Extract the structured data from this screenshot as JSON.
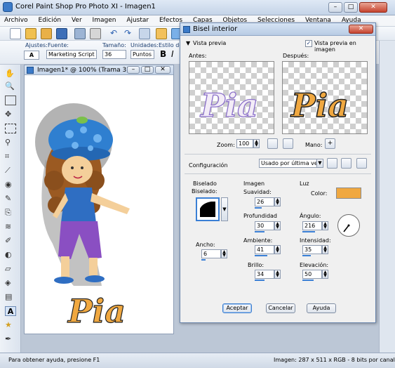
{
  "app": {
    "title": "Corel Paint Shop Pro Photo XI - Imagen1"
  },
  "menu": [
    "Archivo",
    "Edición",
    "Ver",
    "Imagen",
    "Ajustar",
    "Efectos",
    "Capas",
    "Objetos",
    "Selecciones",
    "Ventana",
    "Ayuda"
  ],
  "toolbar2": {
    "ajustes_label": "Ajustes:",
    "fuente_label": "Fuente:",
    "fuente_value": "Marketing Script",
    "tamano_label": "Tamaño:",
    "tamano_value": "36",
    "unidades_label": "Unidades:",
    "unidades_value": "Puntos",
    "estilo_label": "Estilo de F",
    "bold_label": "B",
    "italic_label": "I"
  },
  "image_window": {
    "title": "Imagen1* @ 100% (Trama 3)",
    "artwork_text": "Pia"
  },
  "dialog": {
    "title": "Bisel interior",
    "vista_previa_toggle": "Vista previa",
    "vista_previa_imagen": "Vista previa en imagen",
    "antes_label": "Antes:",
    "despues_label": "Después:",
    "preview_text": "Pia",
    "zoom_label": "Zoom:",
    "zoom_value": "100",
    "mano_label": "Mano:",
    "configuracion_label": "Configuración",
    "configuracion_value": "Usado por última vez",
    "biselado_group": "Biselado",
    "biselado_label": "Biselado:",
    "imagen_group": "Imagen",
    "luz_group": "Luz",
    "suavidad_label": "Suavidad:",
    "suavidad_value": "26",
    "profundidad_label": "Profundidad",
    "profundidad_value": "30",
    "ambiente_label": "Ambiente:",
    "ambiente_value": "41",
    "brillo_label": "Brillo:",
    "brillo_value": "34",
    "ancho_label": "Ancho:",
    "ancho_value": "6",
    "color_label": "Color:",
    "light_color": "#f0a840",
    "angulo_label": "Ángulo:",
    "angulo_value": "216",
    "intensidad_label": "Intensidad:",
    "intensidad_value": "35",
    "elevacion_label": "Elevación:",
    "elevacion_value": "50",
    "aceptar": "Aceptar",
    "cancelar": "Cancelar",
    "ayuda": "Ayuda"
  },
  "status": {
    "left": "Para obtener ayuda, presione F1",
    "right": "Imagen: 287 x 511 x RGB - 8 bits por canal"
  }
}
